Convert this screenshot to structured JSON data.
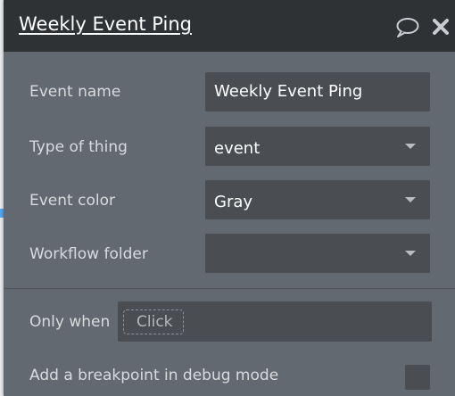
{
  "panel": {
    "title": "Weekly Event Ping",
    "comment_icon": "speech-bubble-icon",
    "close_icon": "close-icon"
  },
  "form": {
    "event_name": {
      "label": "Event name",
      "value": "Weekly Event Ping"
    },
    "type_of_thing": {
      "label": "Type of thing",
      "value": "event"
    },
    "event_color": {
      "label": "Event color",
      "value": "Gray"
    },
    "workflow_folder": {
      "label": "Workflow folder",
      "value": ""
    }
  },
  "conditions": {
    "only_when": {
      "label": "Only when",
      "placeholder": "Click"
    },
    "breakpoint": {
      "label": "Add a breakpoint in debug mode",
      "checked": false
    }
  },
  "colors": {
    "panel_bg": "#636970",
    "titlebar_bg": "#2e3235",
    "field_bg": "#4a4e53"
  }
}
